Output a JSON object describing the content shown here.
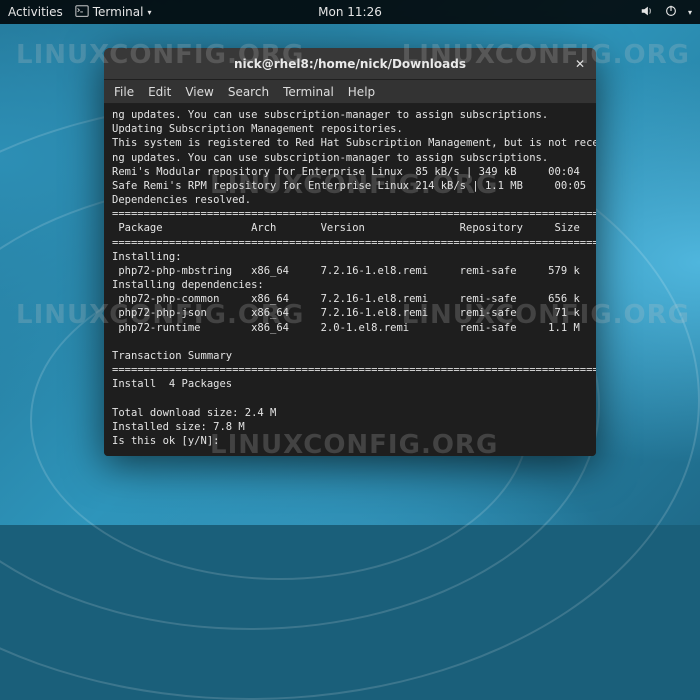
{
  "topbar": {
    "activities": "Activities",
    "app_icon": "terminal-icon",
    "app_name": "Terminal",
    "clock": "Mon 11:26"
  },
  "window": {
    "title": "nick@rhel8:/home/nick/Downloads"
  },
  "menubar": [
    "File",
    "Edit",
    "View",
    "Search",
    "Terminal",
    "Help"
  ],
  "terminal_lines": [
    "ng updates. You can use subscription-manager to assign subscriptions.",
    "Updating Subscription Management repositories.",
    "This system is registered to Red Hat Subscription Management, but is not receivi",
    "ng updates. You can use subscription-manager to assign subscriptions.",
    "Remi's Modular repository for Enterprise Linux  85 kB/s | 349 kB     00:04",
    "Safe Remi's RPM repository for Enterprise Linux 214 kB/s | 1.1 MB     00:05",
    "Dependencies resolved.",
    "================================================================================",
    " Package              Arch       Version               Repository     Size",
    "================================================================================",
    "Installing:",
    " php72-php-mbstring   x86_64     7.2.16-1.el8.remi     remi-safe     579 k",
    "Installing dependencies:",
    " php72-php-common     x86_64     7.2.16-1.el8.remi     remi-safe     656 k",
    " php72-php-json       x86_64     7.2.16-1.el8.remi     remi-safe      71 k",
    " php72-runtime        x86_64     2.0-1.el8.remi        remi-safe     1.1 M",
    "",
    "Transaction Summary",
    "================================================================================",
    "Install  4 Packages",
    "",
    "Total download size: 2.4 M",
    "Installed size: 7.8 M",
    "Is this ok [y/N]: "
  ],
  "watermark": "LINUXCONFIG.ORG"
}
